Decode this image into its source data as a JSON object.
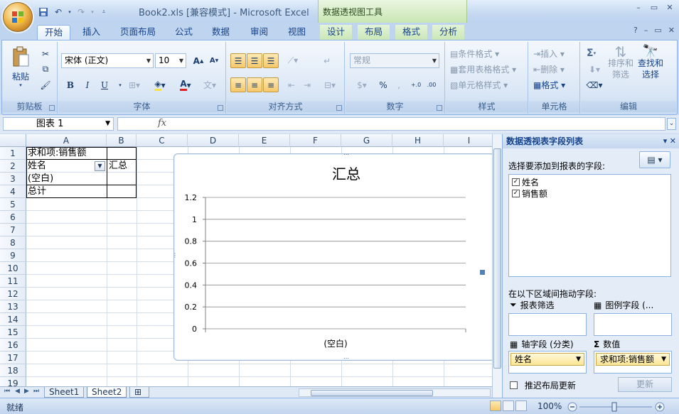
{
  "window": {
    "doc_title": "Book2.xls  [兼容模式] - Microsoft Excel",
    "context_tools": "数据透视图工具"
  },
  "tabs": [
    "开始",
    "插入",
    "页面布局",
    "公式",
    "数据",
    "审阅",
    "视图",
    "设计",
    "布局",
    "格式",
    "分析"
  ],
  "ribbon": {
    "clipboard": {
      "paste": "粘贴",
      "label": "剪贴板"
    },
    "font": {
      "name": "宋体 (正文)",
      "size": "10",
      "label": "字体",
      "bold": "B",
      "italic": "I",
      "underline": "U"
    },
    "alignment": {
      "label": "对齐方式"
    },
    "number": {
      "format": "常规",
      "label": "数字",
      "percent": "%"
    },
    "styles": {
      "cond": "条件格式",
      "table": "套用表格格式",
      "cell": "单元格样式",
      "label": "样式"
    },
    "cells": {
      "insert": "插入",
      "delete": "删除",
      "format": "格式",
      "label": "单元格"
    },
    "editing": {
      "sum": "Σ",
      "sort": "排序和",
      "sort2": "筛选",
      "find": "查找和",
      "find2": "选择",
      "label": "编辑"
    }
  },
  "formula_bar": {
    "name_box": "图表 1",
    "fx": "fx",
    "formula": ""
  },
  "columns": [
    "A",
    "B",
    "C",
    "D",
    "E",
    "F",
    "G",
    "H",
    "I"
  ],
  "rows": [
    "1",
    "2",
    "3",
    "4",
    "5",
    "6",
    "7",
    "8",
    "9",
    "10",
    "11",
    "12",
    "13",
    "14",
    "15",
    "16",
    "17",
    "18",
    "19"
  ],
  "cells": {
    "A1": "求和项:销售额",
    "A2": "姓名",
    "B2": "汇总",
    "A3": "(空白)",
    "A4": "总计"
  },
  "chart_data": {
    "type": "bar",
    "title": "汇总",
    "categories": [
      "(空白)"
    ],
    "series": [
      {
        "values": [
          0
        ]
      }
    ],
    "ylim": [
      0,
      1.2
    ],
    "yticks": [
      "1.2",
      "1",
      "0.8",
      "0.6",
      "0.4",
      "0.2",
      "0"
    ],
    "grid": true,
    "legend": "right"
  },
  "sheet_tabs": [
    "Sheet1",
    "Sheet2"
  ],
  "active_sheet": "Sheet2",
  "pivot_pane": {
    "title": "数据透视表字段列表",
    "choose_label": "选择要添加到报表的字段:",
    "fields": [
      {
        "name": "姓名",
        "checked": true
      },
      {
        "name": "销售额",
        "checked": true
      }
    ],
    "drag_label": "在以下区域间拖动字段:",
    "report_filter": "报表筛选",
    "legend_fields": "图例字段 (...",
    "axis_fields": "轴字段 (分类)",
    "values": "数值",
    "axis_item": "姓名",
    "value_item": "求和项:销售额",
    "defer": "推迟布局更新",
    "update": "更新"
  },
  "status": {
    "text": "就绪",
    "zoom": "100%"
  }
}
